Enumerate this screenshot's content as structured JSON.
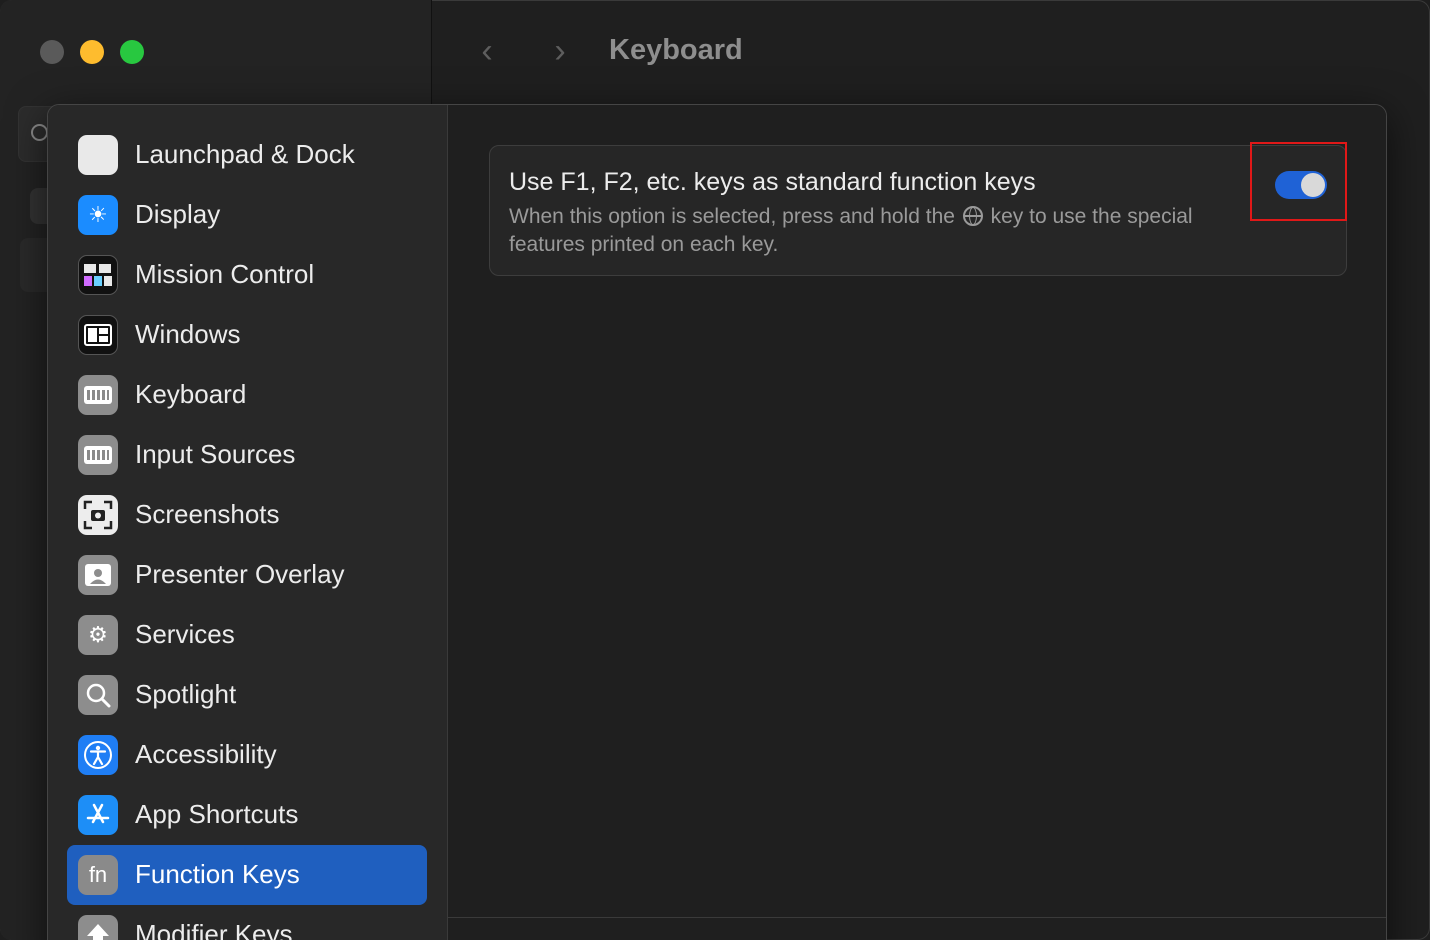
{
  "window": {
    "title": "Keyboard",
    "nav_back_icon": "chevron-left-icon",
    "nav_forward_icon": "chevron-right-icon"
  },
  "sidebar": {
    "items": [
      {
        "label": "Launchpad & Dock",
        "icon": "launchpad-dock-icon"
      },
      {
        "label": "Display",
        "icon": "display-icon"
      },
      {
        "label": "Mission Control",
        "icon": "mission-control-icon"
      },
      {
        "label": "Windows",
        "icon": "windows-icon"
      },
      {
        "label": "Keyboard",
        "icon": "keyboard-icon"
      },
      {
        "label": "Input Sources",
        "icon": "input-sources-icon"
      },
      {
        "label": "Screenshots",
        "icon": "screenshots-icon"
      },
      {
        "label": "Presenter Overlay",
        "icon": "presenter-overlay-icon"
      },
      {
        "label": "Services",
        "icon": "services-icon"
      },
      {
        "label": "Spotlight",
        "icon": "spotlight-icon"
      },
      {
        "label": "Accessibility",
        "icon": "accessibility-icon"
      },
      {
        "label": "App Shortcuts",
        "icon": "app-shortcuts-icon"
      },
      {
        "label": "Function Keys",
        "icon": "fn-icon",
        "selected": true
      },
      {
        "label": "Modifier Keys",
        "icon": "modifier-keys-icon"
      }
    ]
  },
  "function_keys": {
    "option_title": "Use F1, F2, etc. keys as standard function keys",
    "desc_before": "When this option is selected, press and hold the",
    "desc_after": "key to use the special features printed on each key.",
    "toggle_on": true,
    "fn_glyph": "fn"
  },
  "colors": {
    "accent": "#1f62d6",
    "selection": "#1f5fbf",
    "highlight": "#e01818"
  }
}
